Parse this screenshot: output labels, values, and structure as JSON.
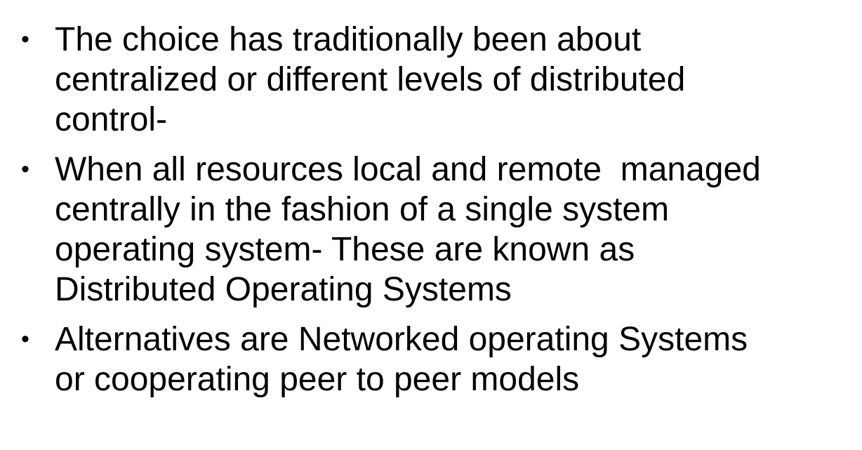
{
  "bullets": [
    {
      "marker": "•",
      "lines": [
        "The choice has traditionally been about",
        "centralized or different levels of distributed",
        "control-"
      ]
    },
    {
      "marker": "•",
      "lines": [
        "When all resources local and remote  managed",
        "centrally in the fashion of a single system",
        "operating system- These are known as",
        "Distributed Operating Systems"
      ]
    },
    {
      "marker": "•",
      "lines": [
        "Alternatives are Networked operating Systems",
        "or cooperating peer to peer models"
      ]
    }
  ]
}
